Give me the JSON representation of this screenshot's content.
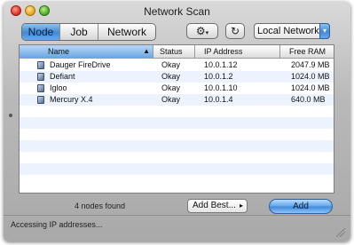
{
  "window": {
    "title": "Network Scan"
  },
  "toolbar": {
    "tabs": [
      {
        "label": "Node",
        "active": true
      },
      {
        "label": "Job",
        "active": false
      },
      {
        "label": "Network",
        "active": false
      }
    ],
    "gear_icon": "gear-icon",
    "refresh_icon": "refresh-icon",
    "location": {
      "selected": "Local Network"
    }
  },
  "table": {
    "columns": [
      "Name",
      "Status",
      "IP Address",
      "Free RAM"
    ],
    "sorted_by": "Name",
    "rows": [
      {
        "name": "Dauger FireDrive",
        "status": "Okay",
        "ip": "10.0.1.12",
        "ram": "2047.9 MB"
      },
      {
        "name": "Defiant",
        "status": "Okay",
        "ip": "10.0.1.2",
        "ram": "1024.0 MB"
      },
      {
        "name": "Igloo",
        "status": "Okay",
        "ip": "10.0.1.10",
        "ram": "1024.0 MB"
      },
      {
        "name": "Mercury X.4",
        "status": "Okay",
        "ip": "10.0.1.4",
        "ram": "640.0 MB"
      }
    ]
  },
  "footer": {
    "nodes_found": "4 nodes found",
    "add_best_label": "Add Best...",
    "add_label": "Add",
    "status": "Accessing IP addresses..."
  },
  "colors": {
    "accent": "#3f8ad6",
    "row_alt": "#edf3fe"
  }
}
